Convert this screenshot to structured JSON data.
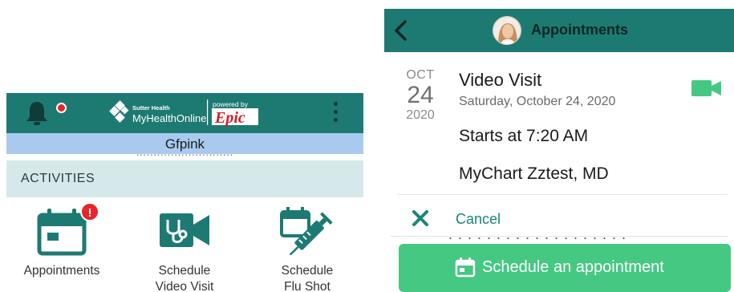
{
  "left_screen": {
    "header": {
      "brand_top": "Sutter Health",
      "brand_name": "MyHealthOnline",
      "powered_by": "powered by",
      "epic": "Epic",
      "notification_icon": "bell-icon",
      "menu_icon": "kebab-menu-icon"
    },
    "user_name": "Gfpink",
    "section_title": "ACTIVITIES",
    "activities": [
      {
        "label_line1": "Appointments",
        "label_line2": "",
        "icon": "calendar-icon",
        "badge": "!"
      },
      {
        "label_line1": "Schedule",
        "label_line2": "Video Visit",
        "icon": "video-stethoscope-icon"
      },
      {
        "label_line1": "Schedule",
        "label_line2": "Flu Shot",
        "icon": "syringe-calendar-icon"
      }
    ]
  },
  "right_screen": {
    "header": {
      "title": "Appointments",
      "back_icon": "chevron-left-icon",
      "avatar": "user-avatar"
    },
    "appointment": {
      "month": "OCT",
      "day": "24",
      "year": "2020",
      "title": "Video Visit",
      "date_full": "Saturday, October 24, 2020",
      "start": "Starts at 7:20 AM",
      "provider": "MyChart Zztest, MD",
      "type_icon": "video-camera-icon"
    },
    "cancel_label": "Cancel",
    "schedule_button": "Schedule an appointment"
  },
  "colors": {
    "header_teal": "#1d7a73",
    "user_bar_blue": "#a9c9ee",
    "section_bg": "#d6e9ea",
    "badge_red": "#e8242b",
    "action_green": "#45c882",
    "cancel_teal": "#1b8578"
  }
}
